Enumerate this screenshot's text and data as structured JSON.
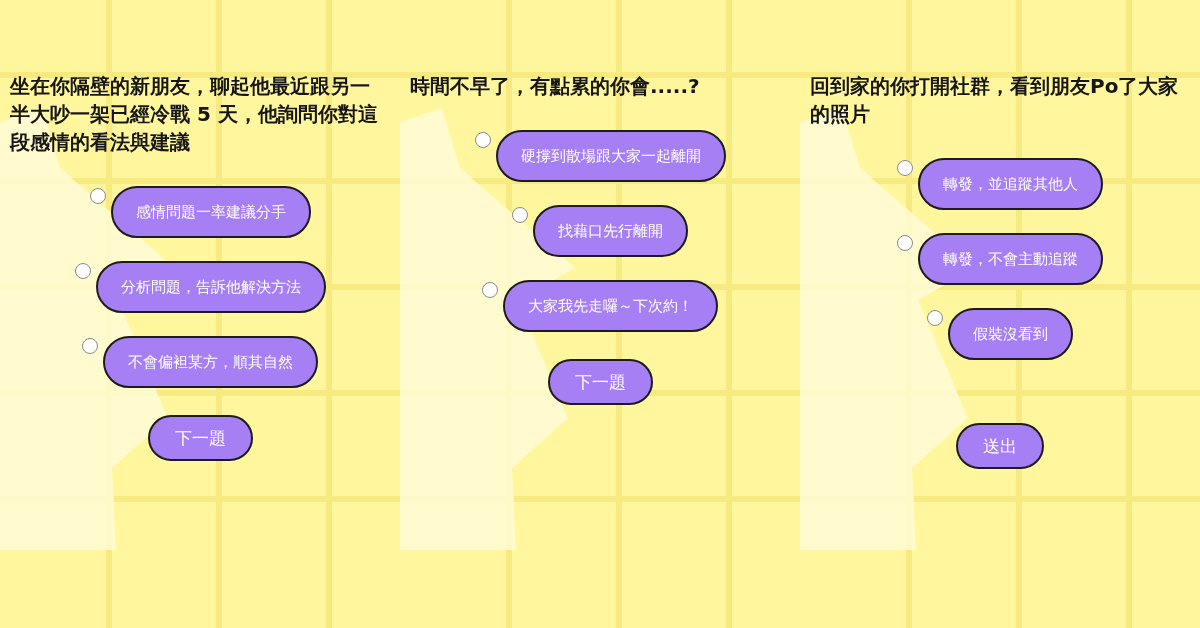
{
  "panels": [
    {
      "question": "坐在你隔壁的新朋友，聊起他最近跟另一半大吵一架已經冷戰 5 天，他詢問你對這段感情的看法與建議",
      "options": [
        {
          "label": "感情問題一率建議分手",
          "selected": false
        },
        {
          "label": "分析問題，告訴他解決方法",
          "selected": false
        },
        {
          "label": "不會偏袒某方，順其自然",
          "selected": false
        }
      ],
      "action": {
        "kind": "next",
        "label": "下一題"
      }
    },
    {
      "question": "時間不早了，有點累的你會.....?",
      "options": [
        {
          "label": "硬撐到散場跟大家一起離開",
          "selected": false
        },
        {
          "label": "找藉口先行離開",
          "selected": false
        },
        {
          "label": "大家我先走囉～下次約！",
          "selected": false
        }
      ],
      "action": {
        "kind": "next",
        "label": "下一題"
      }
    },
    {
      "question": "回到家的你打開社群，看到朋友Po了大家的照片",
      "options": [
        {
          "label": "轉發，並追蹤其他人",
          "selected": false
        },
        {
          "label": "轉發，不會主動追蹤",
          "selected": false
        },
        {
          "label": "假裝沒看到",
          "selected": false
        }
      ],
      "action": {
        "kind": "submit",
        "label": "送出"
      }
    }
  ]
}
